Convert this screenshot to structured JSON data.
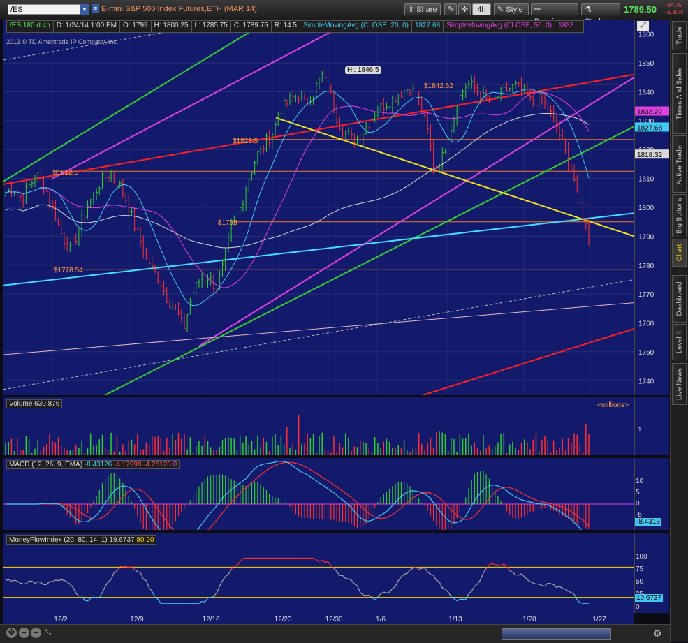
{
  "toolbar": {
    "symbol": "/ES",
    "title": "E-mini S&P 500 Index Futures,ETH (MAR 14)",
    "share": "Share",
    "period": "4h",
    "style": "Style",
    "drawings": "Drawings",
    "studies": "Studies",
    "last_price": "1789.50",
    "change_abs": "-34.75",
    "change_pct": "-1.90%"
  },
  "sidebar": {
    "tabs": [
      "Trade",
      "Times And Sales",
      "Active Trader",
      "Big Buttons",
      "Chart",
      "Dashboard",
      "Level II",
      "Live News"
    ],
    "active": "Chart"
  },
  "info_bar": {
    "symbol": "/ES 180 d 4h",
    "date": "D: 1/24/14 1:00 PM",
    "open": "O: 1799",
    "high": "H: 1800.25",
    "low": "L: 1785.75",
    "close": "C: 1789.75",
    "range": "R: 14.5",
    "sma20_label": "SimpleMovingAvg (CLOSE, 20, 0)",
    "sma20_value": "1827.68",
    "sma50_label": "SimpleMovingAvg (CLOSE, 50, 0)",
    "sma50_value": "1833..."
  },
  "copyright": "2013 © TD Ameritrade IP Company, Inc.",
  "price_axis": {
    "ticks": [
      "1860",
      "1850",
      "1840",
      "1830",
      "1820",
      "1810",
      "1800",
      "1790",
      "1780",
      "1770",
      "1760",
      "1750",
      "1740"
    ],
    "badges": [
      {
        "text": "1833.22",
        "color": "#e040e0",
        "value": 1833.22
      },
      {
        "text": "1827.68",
        "color": "#40c8f0",
        "value": 1827.68
      },
      {
        "text": "1818.32",
        "color": "#d8d8d8",
        "value": 1818.32
      }
    ]
  },
  "annotations": {
    "hi_label": "Hi: 1846.5",
    "levels": [
      "$1842.62",
      "$1823.5",
      "$1812.5",
      "$1795",
      "$1778.54"
    ]
  },
  "volume_panel": {
    "label": "Volume",
    "value": "630,876",
    "units": "<millions>",
    "tick": "1"
  },
  "macd_panel": {
    "label": "MACD (12, 26, 9, EMA)",
    "value1": "-8.43126",
    "value2": "-4.17998",
    "value3": "-4.25128",
    "value4": "0",
    "ticks": [
      "10",
      "5",
      "0",
      "-5"
    ],
    "badge": "-8.4313"
  },
  "mfi_panel": {
    "label": "MoneyFlowIndex (20, 80, 14, 1)",
    "value": "19.6737",
    "upper": "80",
    "lower": "20",
    "ticks": [
      "100",
      "75",
      "50",
      "25",
      "0"
    ],
    "badge": "19.6737"
  },
  "time_axis": [
    "12/2",
    "12/9",
    "12/16",
    "12/23",
    "12/30",
    "1/6",
    "1/13",
    "1/20",
    "1/27"
  ],
  "chart_data": {
    "type": "candlestick",
    "title": "E-mini S&P 500 Index Futures,ETH (MAR 14)",
    "ylim": [
      1735,
      1865
    ],
    "x_labels": [
      "12/2",
      "12/9",
      "12/16",
      "12/23",
      "12/30",
      "1/6",
      "1/13",
      "1/20",
      "1/27"
    ],
    "y_ticks": [
      1740,
      1750,
      1760,
      1770,
      1780,
      1790,
      1800,
      1810,
      1820,
      1830,
      1840,
      1850,
      1860
    ],
    "horizontal_levels": [
      1842.62,
      1823.5,
      1812.5,
      1795,
      1778.54
    ],
    "price_path": [
      1805,
      1807,
      1803,
      1808,
      1811,
      1806,
      1798,
      1790,
      1785,
      1792,
      1800,
      1805,
      1810,
      1812,
      1808,
      1802,
      1793,
      1786,
      1779,
      1775,
      1768,
      1765,
      1758,
      1770,
      1775,
      1776,
      1772,
      1781,
      1795,
      1800,
      1810,
      1818,
      1822,
      1826,
      1834,
      1837,
      1839,
      1836,
      1840,
      1846,
      1840,
      1830,
      1826,
      1823,
      1826,
      1830,
      1834,
      1836,
      1838,
      1840,
      1842,
      1836,
      1828,
      1812,
      1818,
      1828,
      1838,
      1843,
      1841,
      1838,
      1836,
      1839,
      1841,
      1842,
      1840,
      1836,
      1838,
      1834,
      1828,
      1820,
      1812,
      1800,
      1790
    ],
    "last": {
      "open": 1799,
      "high": 1800.25,
      "low": 1785.75,
      "close": 1789.75
    }
  }
}
